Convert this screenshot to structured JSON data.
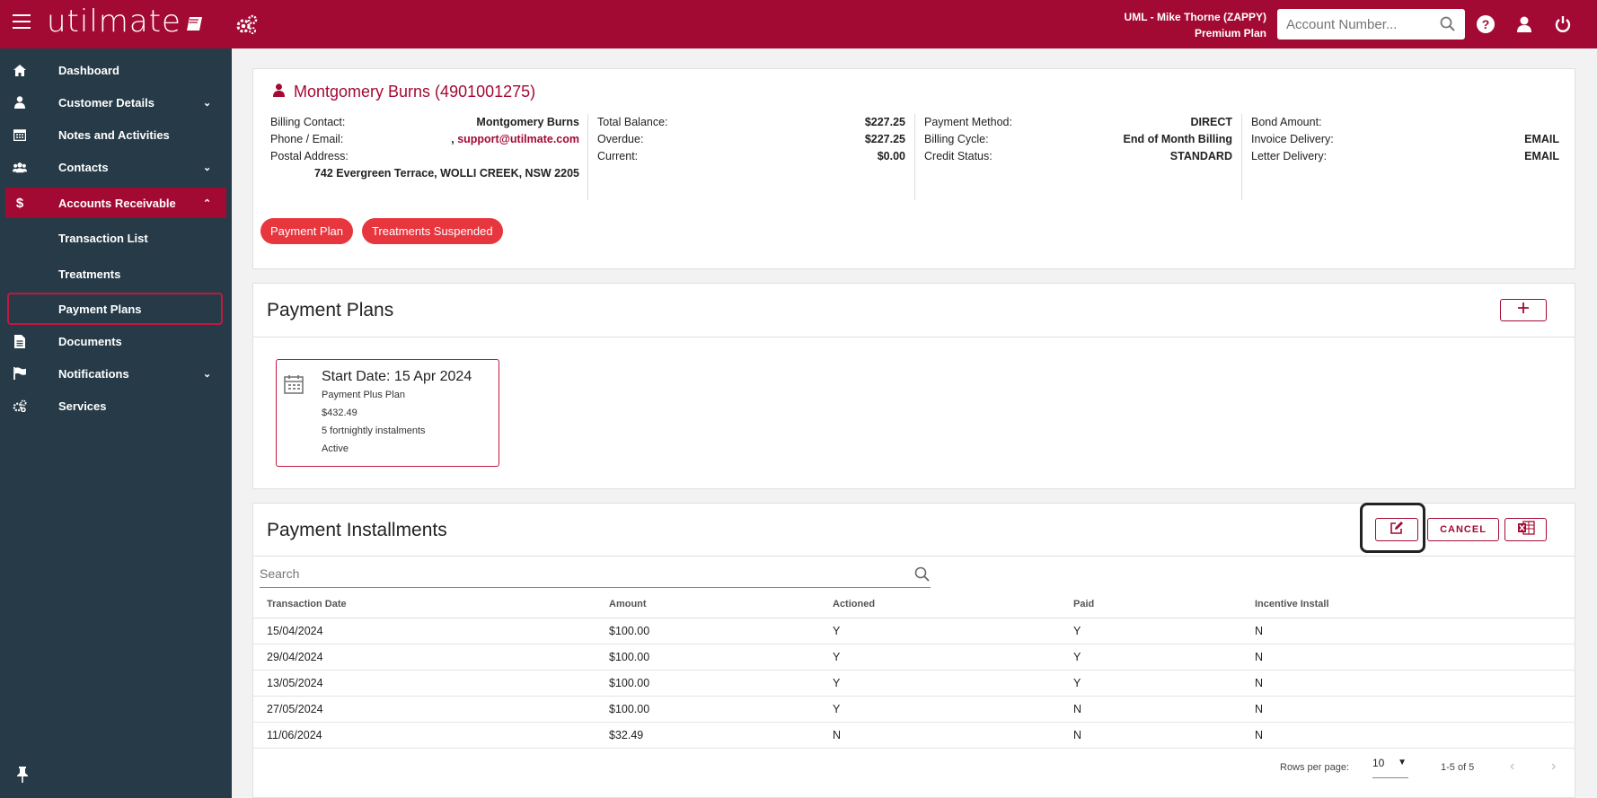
{
  "header": {
    "logo": "utilmate",
    "user_line1": "UML - Mike Thorne (ZAPPY)",
    "user_line2": "Premium Plan",
    "search_placeholder": "Account Number..."
  },
  "sidebar": {
    "items": [
      {
        "label": "Dashboard"
      },
      {
        "label": "Customer Details"
      },
      {
        "label": "Notes and Activities"
      },
      {
        "label": "Contacts"
      },
      {
        "label": "Accounts Receivable"
      },
      {
        "label": "Transaction List"
      },
      {
        "label": "Treatments"
      },
      {
        "label": "Payment Plans"
      },
      {
        "label": "Documents"
      },
      {
        "label": "Notifications"
      },
      {
        "label": "Services"
      }
    ]
  },
  "customer": {
    "title": "Montgomery Burns (4901001275)",
    "col1": {
      "billing_contact_label": "Billing Contact:",
      "billing_contact": "Montgomery Burns",
      "phone_label": "Phone / Email:",
      "phone_prefix": ", ",
      "email": "support@utilmate.com",
      "postal_label": "Postal Address:",
      "postal": "742 Evergreen Terrace, WOLLI CREEK, NSW 2205"
    },
    "col2": {
      "total_label": "Total Balance:",
      "total": "$227.25",
      "overdue_label": "Overdue:",
      "overdue": "$227.25",
      "current_label": "Current:",
      "current": "$0.00"
    },
    "col3": {
      "method_label": "Payment Method:",
      "method": "DIRECT",
      "cycle_label": "Billing Cycle:",
      "cycle": "End of Month Billing",
      "credit_label": "Credit Status:",
      "credit": "STANDARD"
    },
    "col4": {
      "bond_label": "Bond Amount:",
      "bond": "",
      "invoice_label": "Invoice Delivery:",
      "invoice": "EMAIL",
      "letter_label": "Letter Delivery:",
      "letter": "EMAIL"
    },
    "badges": [
      "Payment Plan",
      "Treatments Suspended"
    ]
  },
  "payment_plans": {
    "title": "Payment Plans",
    "plan": {
      "start": "Start Date: 15 Apr 2024",
      "name": "Payment Plus Plan",
      "amount": "$432.49",
      "instalments": "5 fortnightly instalments",
      "status": "Active"
    }
  },
  "installments": {
    "title": "Payment Installments",
    "cancel_label": "CANCEL",
    "search_placeholder": "Search",
    "columns": [
      "Transaction Date",
      "Amount",
      "Actioned",
      "Paid",
      "Incentive Install"
    ],
    "rows": [
      [
        "15/04/2024",
        "$100.00",
        "Y",
        "Y",
        "N"
      ],
      [
        "29/04/2024",
        "$100.00",
        "Y",
        "Y",
        "N"
      ],
      [
        "13/05/2024",
        "$100.00",
        "Y",
        "Y",
        "N"
      ],
      [
        "27/05/2024",
        "$100.00",
        "Y",
        "N",
        "N"
      ],
      [
        "11/06/2024",
        "$32.49",
        "N",
        "N",
        "N"
      ]
    ],
    "rows_per_page_label": "Rows per page:",
    "rows_per_page": "10",
    "range": "1-5 of 5"
  },
  "colors": {
    "brand": "#a30a33",
    "sidebar": "#263b47",
    "badge": "#e8363f"
  }
}
